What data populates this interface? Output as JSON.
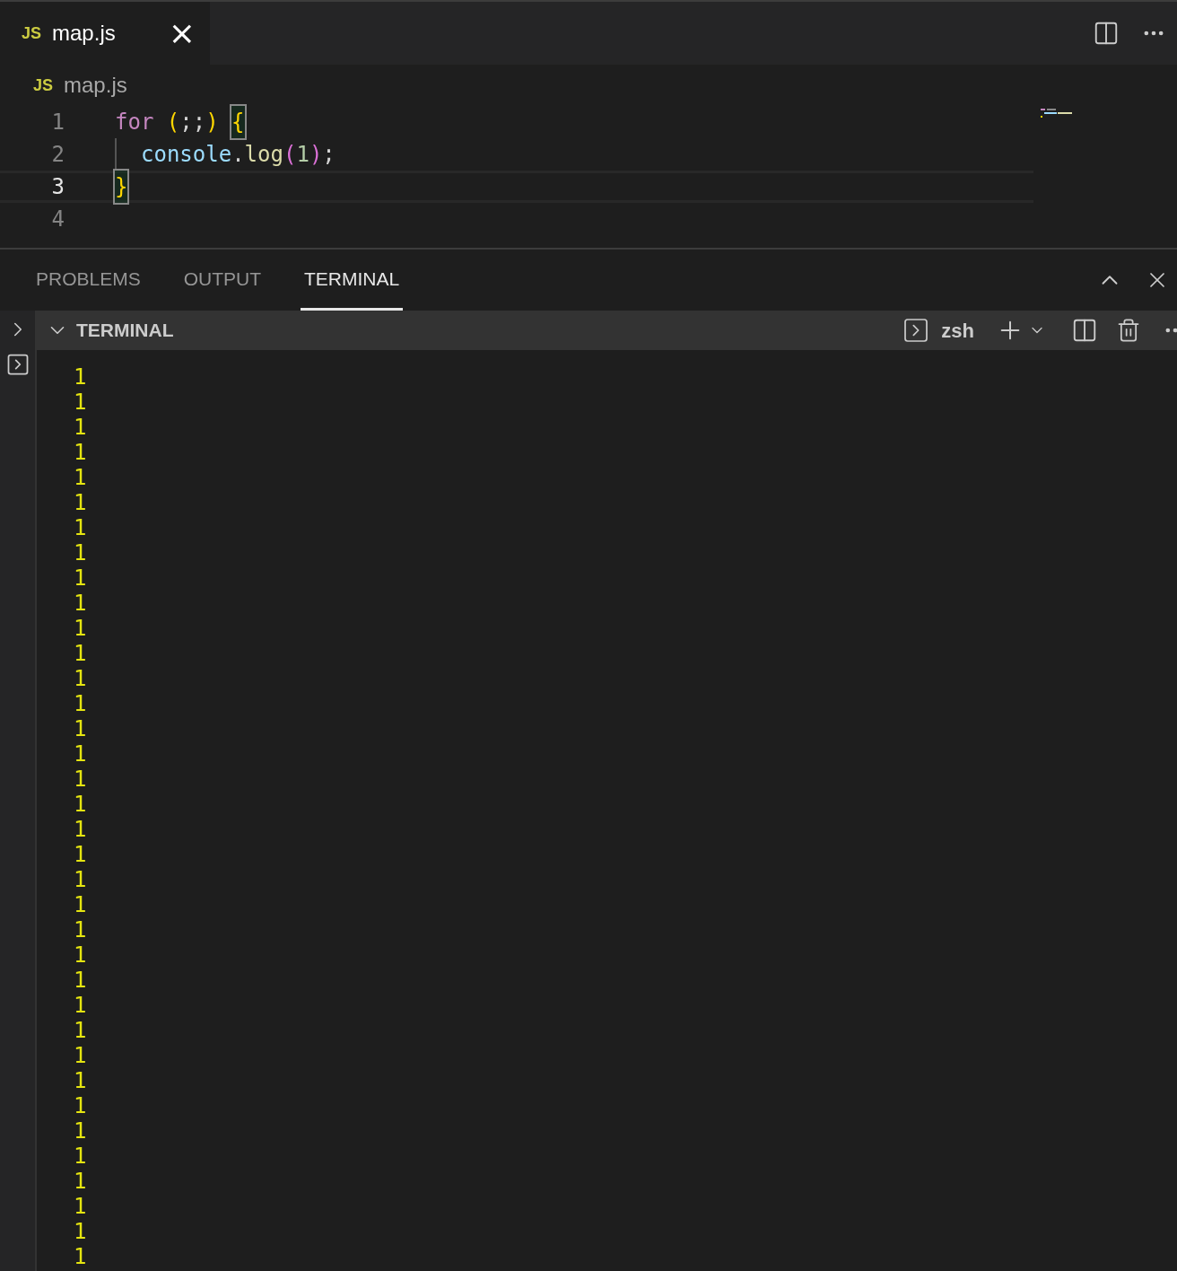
{
  "editor_tabs": [
    {
      "badge": "JS",
      "label": "map.js",
      "close": "×",
      "selected": true
    }
  ],
  "breadcrumb": {
    "badge": "JS",
    "label": "map.js"
  },
  "code_lines": [
    {
      "number": "1",
      "current": false,
      "tokens": [
        {
          "kind": "keyword",
          "text": "for"
        },
        {
          "kind": "paren",
          "text": " ("
        },
        {
          "kind": "plain",
          "text": ";;"
        },
        {
          "kind": "paren",
          "text": ") "
        },
        {
          "kind": "brace",
          "text": "{",
          "matched": true
        }
      ]
    },
    {
      "number": "2",
      "current": false,
      "indent": true,
      "tokens": [
        {
          "kind": "variable",
          "text": "console"
        },
        {
          "kind": "plain",
          "text": "."
        },
        {
          "kind": "function",
          "text": "log"
        },
        {
          "kind": "paren2",
          "text": "("
        },
        {
          "kind": "number",
          "text": "1"
        },
        {
          "kind": "paren2",
          "text": ")"
        },
        {
          "kind": "plain",
          "text": ";"
        }
      ]
    },
    {
      "number": "3",
      "current": true,
      "tokens": [
        {
          "kind": "brace",
          "text": "}",
          "matched": true
        }
      ]
    },
    {
      "number": "4",
      "current": false
    }
  ],
  "panel_tabs": [
    {
      "label": "PROBLEMS",
      "selected": false
    },
    {
      "label": "OUTPUT",
      "selected": false
    },
    {
      "label": "TERMINAL",
      "selected": true
    }
  ],
  "terminal": {
    "title": "TERMINAL",
    "expanded": true,
    "shell": "zsh",
    "output": [
      "1",
      "1",
      "1",
      "1",
      "1",
      "1",
      "1",
      "1",
      "1",
      "1",
      "1",
      "1",
      "1",
      "1",
      "1",
      "1",
      "1",
      "1",
      "1",
      "1",
      "1",
      "1",
      "1",
      "1",
      "1",
      "1",
      "1",
      "1",
      "1",
      "1",
      "1",
      "1",
      "1",
      "1",
      "1",
      "1"
    ]
  }
}
